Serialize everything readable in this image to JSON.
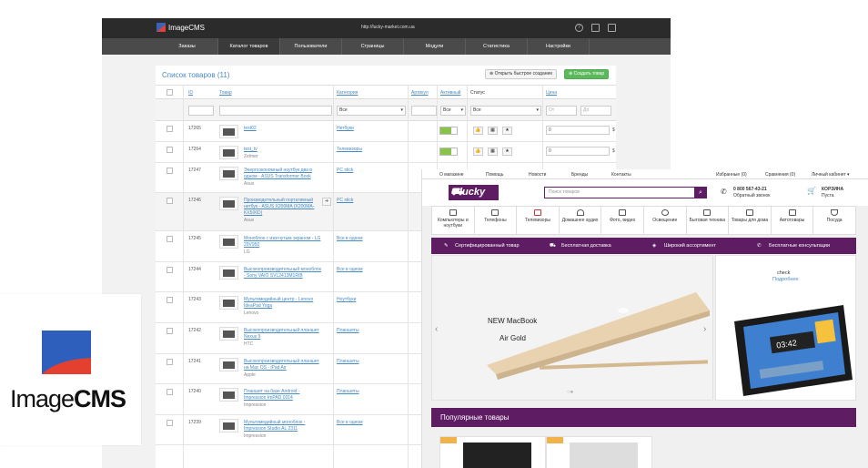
{
  "admin": {
    "logo_text": "ImageCMS",
    "url": "http://lucky-market.com.ua",
    "menu": [
      "Заказы",
      "Каталог товаров",
      "Пользователи",
      "Страницы",
      "Модули",
      "Статистика",
      "Настройки"
    ],
    "title": "Список товаров (11)",
    "quick_create": "Открыть быстрое создание",
    "create": "Создать товар",
    "columns": {
      "id": "ID",
      "product": "Товар",
      "category": "Категория",
      "sku": "Артикул",
      "active": "Активный",
      "status": "Статус",
      "price": "Цена"
    },
    "filter": {
      "all1": "Все",
      "all2": "Все",
      "all3": "Все",
      "from": "От",
      "to": "До"
    },
    "rows": [
      {
        "id": "17265",
        "name": "test02",
        "brand": "",
        "category": "Нетбуки",
        "price": "0",
        "cur": "$"
      },
      {
        "id": "17264",
        "name": "test_tv",
        "brand": "Zelmer",
        "category": "Телевизоры",
        "price": "0",
        "cur": "$"
      },
      {
        "id": "17247",
        "name": "Энергоэкономный ноутбук два в одном - ASUS Transformer Book",
        "brand": "Asus",
        "category": "PC stick",
        "price": "",
        "cur": ""
      },
      {
        "id": "17246",
        "name": "Производительный портативный нетбук - ASUS X200MA (X200MA-KX506D)",
        "brand": "Asus",
        "category": "PC stick",
        "price": "",
        "cur": ""
      },
      {
        "id": "17245",
        "name": "Моноблок с изогнутым экраном - LG 29V950",
        "brand": "LG",
        "category": "Все в одном",
        "price": "",
        "cur": ""
      },
      {
        "id": "17244",
        "name": "Высокопроизводительный моноблок - Sony VAIO SVL2413M1R/B",
        "brand": "",
        "category": "Все в одном",
        "price": "",
        "cur": ""
      },
      {
        "id": "17243",
        "name": "Мультимедийный центр - Lenovo IdeaPad Yoga",
        "brand": "Lenovo",
        "category": "Ноутбуки",
        "price": "",
        "cur": ""
      },
      {
        "id": "17242",
        "name": "Высокопроизводительный планшет Nexus 9",
        "brand": "HTC",
        "category": "Планшеты",
        "price": "",
        "cur": ""
      },
      {
        "id": "17241",
        "name": "Высокопроизводительный планшет на Mac OS - iPad Air",
        "brand": "Apple",
        "category": "Планшеты",
        "price": "",
        "cur": ""
      },
      {
        "id": "17240",
        "name": "Планшет на базе Android - Impression ImPAD 0314",
        "brand": "Impression",
        "category": "Планшеты",
        "price": "",
        "cur": ""
      },
      {
        "id": "17239",
        "name": "Мультимедийный моноблок - Impression Studio AL 2311",
        "brand": "Impression",
        "category": "Все в одном",
        "price": "",
        "cur": ""
      }
    ]
  },
  "biglogo": {
    "text_light": "Image",
    "text_bold": "CMS"
  },
  "shop": {
    "top_links": [
      "О магазине",
      "Помощь",
      "Новости",
      "Бренды",
      "Контакты"
    ],
    "top_right": [
      "Избранные (0)",
      "Сравнения (0)",
      "Личный кабинет ▾"
    ],
    "logo": "lucky",
    "logo_sub": "market",
    "search_placeholder": "Поиск товаров",
    "phone": "0 800 567-43-21",
    "callback": "Обратный звонок",
    "cart_title": "КОРЗИНА",
    "cart_sub": "Пуста",
    "categories": [
      "Компьютеры и ноутбуки",
      "Телефоны",
      "Телевизоры",
      "Домашнее аудио",
      "Фото, видео",
      "Освещение",
      "Бытовая техника",
      "Товары для дома",
      "Автотовары",
      "Посуда"
    ],
    "strip": [
      "Сертифицированный товар",
      "Бесплатная доставка",
      "Широкий ассортимент",
      "Бесплатные консультации"
    ],
    "slide_line1": "NEW MacBook",
    "slide_line2": "Air Gold",
    "side_check": "check",
    "side_more": "Подробнее",
    "tablet_time": "03:42",
    "popular": "Популярные товары"
  }
}
